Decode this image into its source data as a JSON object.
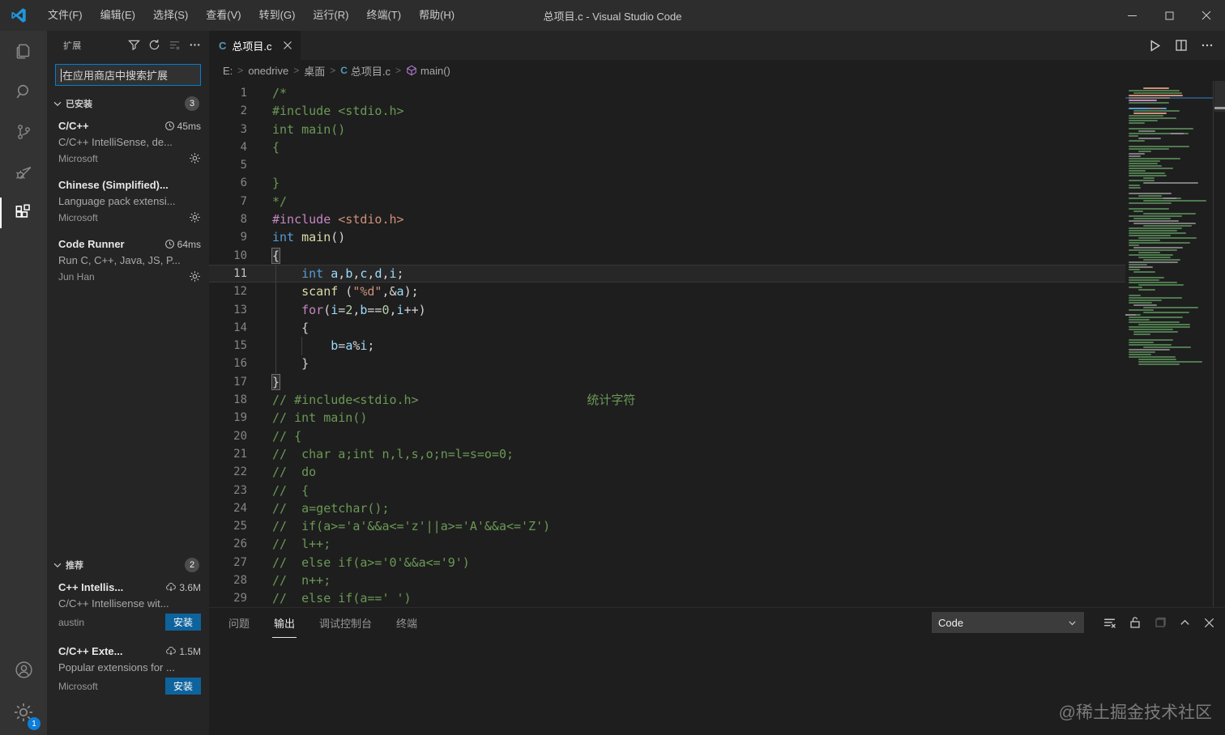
{
  "window": {
    "title": "总项目.c - Visual Studio Code",
    "menus": [
      "文件(F)",
      "编辑(E)",
      "选择(S)",
      "查看(V)",
      "转到(G)",
      "运行(R)",
      "终端(T)",
      "帮助(H)"
    ]
  },
  "activity_bar": {
    "items": [
      "explorer",
      "search",
      "source-control",
      "run-and-debug",
      "extensions"
    ],
    "active_item": "extensions",
    "settings_badge": "1"
  },
  "sidebar": {
    "title": "扩展",
    "search_placeholder": "在应用商店中搜索扩展",
    "sections": [
      {
        "label": "已安装",
        "badge": "3",
        "items": [
          {
            "name": "C/C++",
            "meta": "45ms",
            "meta_icon": "clock",
            "desc": "C/C++ IntelliSense, de...",
            "publisher": "Microsoft",
            "action": "gear"
          },
          {
            "name": "Chinese (Simplified)...",
            "meta": "",
            "meta_icon": "",
            "desc": "Language pack extensi...",
            "publisher": "Microsoft",
            "action": "gear"
          },
          {
            "name": "Code Runner",
            "meta": "64ms",
            "meta_icon": "clock",
            "desc": "Run C, C++, Java, JS, P...",
            "publisher": "Jun Han",
            "action": "gear"
          }
        ]
      },
      {
        "label": "推荐",
        "badge": "2",
        "items": [
          {
            "name": "C++ Intellis...",
            "meta": "3.6M",
            "meta_icon": "cloud",
            "desc": "C/C++ Intellisense wit...",
            "publisher": "austin",
            "action": "install",
            "action_label": "安装"
          },
          {
            "name": "C/C++ Exte...",
            "meta": "1.5M",
            "meta_icon": "cloud",
            "desc": "Popular extensions for ...",
            "publisher": "Microsoft",
            "action": "install",
            "action_label": "安装"
          }
        ]
      }
    ]
  },
  "editor": {
    "tab": {
      "label": "总项目.c"
    },
    "breadcrumb": [
      {
        "label": "E:"
      },
      {
        "label": "onedrive"
      },
      {
        "label": "桌面"
      },
      {
        "label": "总项目.c",
        "icon": "c-file"
      },
      {
        "label": "main()",
        "icon": "symbol-method"
      }
    ],
    "current_line": 11,
    "code_lines": [
      {
        "n": 1,
        "tokens": [
          [
            "c",
            "/*"
          ]
        ]
      },
      {
        "n": 2,
        "tokens": [
          [
            "c",
            "#include <stdio.h>"
          ]
        ]
      },
      {
        "n": 3,
        "tokens": [
          [
            "c",
            "int main()"
          ]
        ]
      },
      {
        "n": 4,
        "tokens": [
          [
            "c",
            "{"
          ]
        ]
      },
      {
        "n": 5,
        "tokens": []
      },
      {
        "n": 6,
        "tokens": [
          [
            "c",
            "}"
          ]
        ]
      },
      {
        "n": 7,
        "tokens": [
          [
            "c",
            "*/"
          ]
        ]
      },
      {
        "n": 8,
        "tokens": [
          [
            "k",
            "#include"
          ],
          [
            "p",
            " "
          ],
          [
            "s",
            "<stdio.h>"
          ]
        ]
      },
      {
        "n": 9,
        "tokens": [
          [
            "t",
            "int"
          ],
          [
            "p",
            " "
          ],
          [
            "f",
            "main"
          ],
          [
            "p",
            "()"
          ]
        ]
      },
      {
        "n": 10,
        "tokens": [
          [
            "p",
            "{",
            "m"
          ]
        ]
      },
      {
        "n": 11,
        "tokens": [
          [
            "p",
            "    "
          ],
          [
            "t",
            "int"
          ],
          [
            "p",
            " "
          ],
          [
            "v",
            "a"
          ],
          [
            "p",
            ","
          ],
          [
            "v",
            "b"
          ],
          [
            "p",
            ","
          ],
          [
            "v",
            "c"
          ],
          [
            "p",
            ","
          ],
          [
            "v",
            "d"
          ],
          [
            "p",
            ","
          ],
          [
            "v",
            "i"
          ],
          [
            "p",
            ";"
          ]
        ]
      },
      {
        "n": 12,
        "tokens": [
          [
            "p",
            "    "
          ],
          [
            "f",
            "scanf"
          ],
          [
            "p",
            " ("
          ],
          [
            "s",
            "\"%d\""
          ],
          [
            "p",
            ","
          ],
          [
            "p",
            "&"
          ],
          [
            "v",
            "a"
          ],
          [
            "p",
            ");"
          ]
        ]
      },
      {
        "n": 13,
        "tokens": [
          [
            "p",
            "    "
          ],
          [
            "k",
            "for"
          ],
          [
            "p",
            "("
          ],
          [
            "v",
            "i"
          ],
          [
            "p",
            "="
          ],
          [
            "n",
            "2"
          ],
          [
            "p",
            ","
          ],
          [
            "v",
            "b"
          ],
          [
            "p",
            "=="
          ],
          [
            "n",
            "0"
          ],
          [
            "p",
            ","
          ],
          [
            "v",
            "i"
          ],
          [
            "p",
            "++)"
          ]
        ]
      },
      {
        "n": 14,
        "tokens": [
          [
            "p",
            "    {"
          ]
        ]
      },
      {
        "n": 15,
        "tokens": [
          [
            "p",
            "        "
          ],
          [
            "v",
            "b"
          ],
          [
            "p",
            "="
          ],
          [
            "v",
            "a"
          ],
          [
            "p",
            "%"
          ],
          [
            "v",
            "i"
          ],
          [
            "p",
            ";"
          ]
        ]
      },
      {
        "n": 16,
        "tokens": [
          [
            "p",
            "    }"
          ]
        ]
      },
      {
        "n": 17,
        "tokens": [
          [
            "p",
            "}",
            "m"
          ]
        ]
      },
      {
        "n": 18,
        "tokens": [
          [
            "c",
            "// #include<stdio.h>"
          ],
          [
            "p",
            "                       "
          ],
          [
            "c",
            "统计字符"
          ]
        ]
      },
      {
        "n": 19,
        "tokens": [
          [
            "c",
            "// int main()"
          ]
        ]
      },
      {
        "n": 20,
        "tokens": [
          [
            "c",
            "// {"
          ]
        ]
      },
      {
        "n": 21,
        "tokens": [
          [
            "c",
            "//  char a;int n,l,s,o;n=l=s=o=0;"
          ]
        ]
      },
      {
        "n": 22,
        "tokens": [
          [
            "c",
            "//  do"
          ]
        ]
      },
      {
        "n": 23,
        "tokens": [
          [
            "c",
            "//  {"
          ]
        ]
      },
      {
        "n": 24,
        "tokens": [
          [
            "c",
            "//  a=getchar();"
          ]
        ]
      },
      {
        "n": 25,
        "tokens": [
          [
            "c",
            "//  if(a>='a'&&a<='z'||a>='A'&&a<='Z')"
          ]
        ]
      },
      {
        "n": 26,
        "tokens": [
          [
            "c",
            "//  l++;"
          ]
        ]
      },
      {
        "n": 27,
        "tokens": [
          [
            "c",
            "//  else if(a>='0'&&a<='9')"
          ]
        ]
      },
      {
        "n": 28,
        "tokens": [
          [
            "c",
            "//  n++;"
          ]
        ]
      },
      {
        "n": 29,
        "tokens": [
          [
            "c",
            "//  else if(a==' ')"
          ]
        ]
      }
    ]
  },
  "panel": {
    "tabs": [
      {
        "label": "问题",
        "active": false
      },
      {
        "label": "输出",
        "active": true
      },
      {
        "label": "调试控制台",
        "active": false
      },
      {
        "label": "终端",
        "active": false
      }
    ],
    "channel": "Code"
  },
  "watermark": "@稀土掘金技术社区",
  "colors": {
    "ui": {
      "accent": "#0e639c",
      "accent2": "#0d7ed9",
      "focus": "#007fd4",
      "badge": "#4d4d4d",
      "mmline": "#2b4f72"
    },
    "tokens": {
      "c": "#6a9955",
      "k": "#c586c0",
      "s": "#ce9178",
      "t": "#569cd6",
      "f": "#dcdcaa",
      "v": "#9cdcfe",
      "n": "#b5cea8",
      "p": "#d4d4d4"
    }
  }
}
